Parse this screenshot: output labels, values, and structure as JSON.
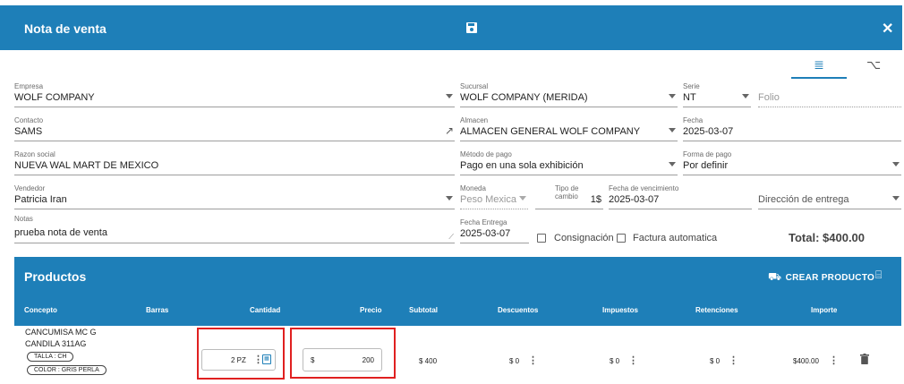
{
  "header": {
    "title": "Nota de venta"
  },
  "form": {
    "empresa": {
      "label": "Empresa",
      "value": "WOLF COMPANY"
    },
    "sucursal": {
      "label": "Sucursal",
      "value": "WOLF COMPANY (MERIDA)"
    },
    "serie": {
      "label": "Serie",
      "value": "NT"
    },
    "folio": {
      "placeholder": "Folio"
    },
    "contacto": {
      "label": "Contacto",
      "value": "SAMS"
    },
    "almacen": {
      "label": "Almacen",
      "value": "ALMACEN GENERAL WOLF COMPANY"
    },
    "fecha": {
      "label": "Fecha",
      "value": "2025-03-07"
    },
    "razon_social": {
      "label": "Razon social",
      "value": "NUEVA WAL MART DE MEXICO"
    },
    "metodo_pago": {
      "label": "Método de pago",
      "value": "Pago en una sola exhibición"
    },
    "forma_pago": {
      "label": "Forma de pago",
      "value": "Por definir"
    },
    "vendedor": {
      "label": "Vendedor",
      "value": "Patricia Iran"
    },
    "moneda": {
      "label": "Moneda",
      "value": "Peso Mexica"
    },
    "tipo_cambio": {
      "label": "Tipo de cambio",
      "value": "1$"
    },
    "fecha_vencimiento": {
      "label": "Fecha de vencimiento",
      "value": "2025-03-07"
    },
    "direccion_entrega": {
      "placeholder": "Dirección de entrega"
    },
    "notas": {
      "label": "Notas",
      "value": "prueba nota de venta"
    },
    "fecha_entrega": {
      "label": "Fecha Entrega",
      "value": "2025-03-07"
    },
    "consignacion": "Consignación",
    "factura_automatica": "Factura automatica",
    "total": "Total: $400.00"
  },
  "productos": {
    "title": "Productos",
    "crear_label": "CREAR PRODUCTO",
    "columns": [
      "Concepto",
      "Barras",
      "Cantidad",
      "Precio",
      "Subtotal",
      "Descuentos",
      "Impuestos",
      "Retenciones",
      "Importe"
    ],
    "rows": [
      {
        "concepto_line1": "CANCUMISA MC G",
        "concepto_line2": "CANDILA 311AG",
        "chip1": "TALLA : CH",
        "chip2": "COLOR : GRIS PERLA",
        "cantidad": "2 PZ",
        "precio_symbol": "$",
        "precio": "200",
        "subtotal": "$ 400",
        "descuentos": "$ 0",
        "impuestos": "$ 0",
        "retenciones": "$ 0",
        "importe": "$400.00"
      }
    ]
  },
  "colors": {
    "accent": "#1e7fb8",
    "highlight": "#e02020"
  }
}
